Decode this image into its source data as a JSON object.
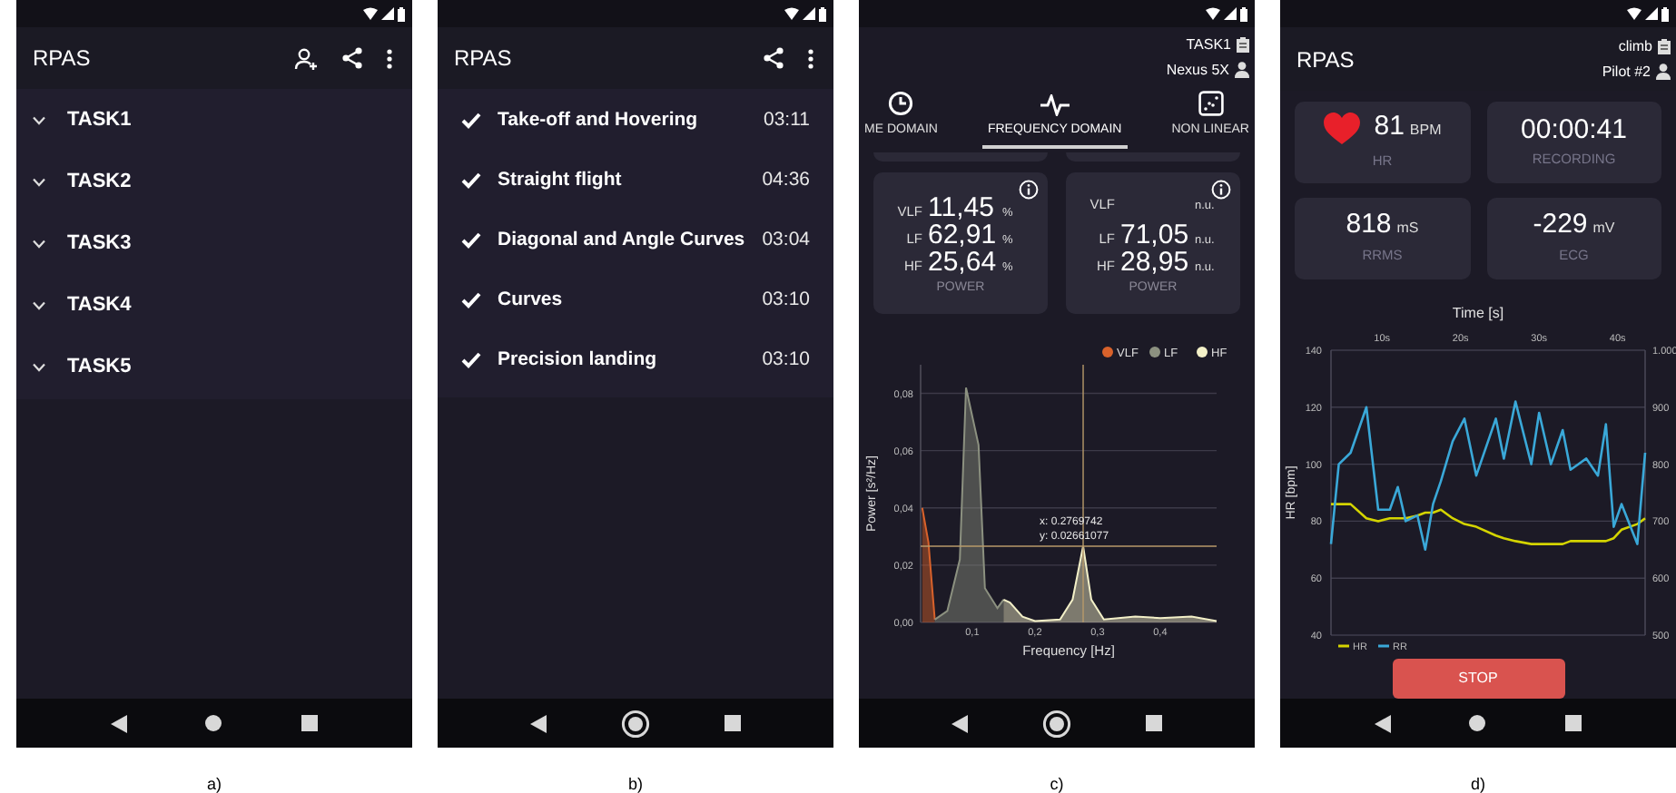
{
  "panels": [
    {
      "kind": "task_list",
      "caption": "a)",
      "app_bar": {
        "title": "RPAS"
      },
      "tasks": [
        {
          "label": "TASK1",
          "expanded": false
        },
        {
          "label": "TASK2",
          "expanded": false
        },
        {
          "label": "TASK3",
          "expanded": false
        },
        {
          "label": "TASK4",
          "expanded": false
        },
        {
          "label": "TASK5",
          "expanded": false
        }
      ]
    },
    {
      "kind": "checklist",
      "caption": "b)",
      "app_bar": {
        "title": "RPAS"
      },
      "items": [
        {
          "label": "Take-off and Hovering",
          "time": "03:11",
          "checked": true
        },
        {
          "label": "Straight flight",
          "time": "04:36",
          "checked": true
        },
        {
          "label": "Diagonal and Angle Curves",
          "time": "03:04",
          "checked": true
        },
        {
          "label": "Curves",
          "time": "03:10",
          "checked": true
        },
        {
          "label": "Precision landing",
          "time": "03:10",
          "checked": true
        }
      ]
    },
    {
      "kind": "frequency",
      "caption": "c)",
      "header": {
        "task": "TASK1",
        "device": "Nexus 5X"
      },
      "tabs": [
        {
          "label": "ME DOMAIN",
          "kind": "clock",
          "selected": false
        },
        {
          "label": "FREQUENCY DOMAIN",
          "kind": "pulse",
          "selected": true
        },
        {
          "label": "NON LINEAR",
          "kind": "scatter",
          "selected": false
        }
      ],
      "cards": [
        {
          "rows": [
            {
              "band": "VLF",
              "value": "11,45",
              "unit": "%"
            },
            {
              "band": "LF",
              "value": "62,91",
              "unit": "%"
            },
            {
              "band": "HF",
              "value": "25,64",
              "unit": "%"
            }
          ],
          "caption": "POWER"
        },
        {
          "rows": [
            {
              "band": "VLF",
              "unit": "n.u."
            },
            {
              "band": "LF",
              "value": "71,05",
              "unit": "n.u."
            },
            {
              "band": "HF",
              "value": "28,95",
              "unit": "n.u."
            }
          ],
          "caption": "POWER"
        }
      ],
      "chart_data": {
        "type": "area",
        "xlabel": "Frequency [Hz]",
        "ylabel": "Power [s²/Hz]",
        "xlim": [
          0.0175,
          0.49
        ],
        "ylim": [
          0,
          0.09
        ],
        "xticks": [
          {
            "value": 0.1,
            "label": "0,1"
          },
          {
            "value": 0.2,
            "label": "0,2"
          },
          {
            "value": 0.3,
            "label": "0,3"
          },
          {
            "value": 0.4,
            "label": "0,4"
          }
        ],
        "yticks": [
          {
            "value": 0,
            "label": "0,00"
          },
          {
            "value": 0.02,
            "label": "0,02"
          },
          {
            "value": 0.04,
            "label": "0,04"
          },
          {
            "value": 0.06,
            "label": "0,06"
          },
          {
            "value": 0.08,
            "label": "0,08"
          }
        ],
        "x": [
          0.02,
          0.03,
          0.04,
          0.06,
          0.08,
          0.09,
          0.11,
          0.12,
          0.14,
          0.15,
          0.16,
          0.18,
          0.2,
          0.24,
          0.26,
          0.277,
          0.29,
          0.31,
          0.36,
          0.4,
          0.45,
          0.49
        ],
        "series": [
          {
            "name": "VLF",
            "color": "#d9622b",
            "values": [
              0.04,
              0.028,
              0.001,
              null,
              null,
              null,
              null,
              null,
              null,
              null,
              null,
              null,
              null,
              null,
              null,
              null,
              null,
              null,
              null,
              null,
              null,
              null
            ]
          },
          {
            "name": "LF",
            "color": "#8c9180",
            "values": [
              null,
              null,
              0.001,
              0.004,
              0.022,
              0.082,
              0.062,
              0.012,
              0.005,
              0.008,
              null,
              null,
              null,
              null,
              null,
              null,
              null,
              null,
              null,
              null,
              null,
              null
            ]
          },
          {
            "name": "HF",
            "color": "#f3f0c8",
            "values": [
              null,
              null,
              null,
              null,
              null,
              null,
              null,
              null,
              null,
              0.008,
              0.007,
              0.002,
              0.0005,
              0.001,
              0.008,
              0.0266,
              0.008,
              0.001,
              0.002,
              0.0015,
              0.002,
              0.0005
            ]
          }
        ],
        "grid": true,
        "legend": "upper right",
        "ref_lines": [
          {
            "axis": "x",
            "value": 0.2769742,
            "color": "#b89a6a"
          },
          {
            "axis": "y",
            "value": 0.02661077,
            "color": "#b89a6a"
          }
        ],
        "annotations": [
          {
            "text": "x: 0.2769742",
            "x": 0.2769742,
            "y": 0.02661077
          },
          {
            "text": "y: 0.02661077",
            "x": 0.2769742,
            "y": 0.02661077
          }
        ]
      }
    },
    {
      "kind": "monitor",
      "caption": "d)",
      "app_bar": {
        "title": "RPAS",
        "task": "climb",
        "pilot": "Pilot #2"
      },
      "cards": [
        {
          "kind": "heart",
          "value": "81",
          "unit": "BPM",
          "label": "HR"
        },
        {
          "kind": "plain",
          "value": "00:00:41",
          "label": "RECORDING"
        },
        {
          "kind": "plain",
          "value": "818",
          "unit": "mS",
          "label": "RRMS"
        },
        {
          "kind": "plain",
          "value": "-229",
          "unit": "mV",
          "label": "ECG"
        }
      ],
      "chart_data": {
        "type": "line",
        "grid": true,
        "legend": "lower left",
        "xlabel": "Time [s]",
        "ylabel": "HR [bpm]",
        "xlim": [
          3.5,
          43.5
        ],
        "ylim": [
          40,
          140
        ],
        "y2lim": [
          500,
          1000
        ],
        "xticks": [
          {
            "value": 10,
            "label": "10s"
          },
          {
            "value": 20,
            "label": "20s"
          },
          {
            "value": 30,
            "label": "30s"
          },
          {
            "value": 40,
            "label": "40s"
          }
        ],
        "yticks": [
          40,
          60,
          80,
          100,
          120,
          140
        ],
        "y2ticks": [
          500,
          600,
          700,
          800,
          900,
          {
            "value": 1000,
            "label": "1.000"
          }
        ],
        "x": [
          3.5,
          4.5,
          6,
          8,
          9.5,
          11,
          12,
          13,
          14.5,
          15.5,
          16.5,
          17.5,
          19,
          20.5,
          22,
          24.5,
          25.5,
          27,
          29,
          30,
          31.5,
          33,
          34,
          36,
          37.5,
          38.5,
          39.5,
          40.5,
          42.5,
          43.5
        ],
        "series": [
          {
            "name": "HR",
            "color": "#d4d400",
            "values": [
              86,
              86,
              86,
              81,
              80,
              81,
              81,
              81,
              82,
              83,
              83,
              84,
              81,
              79,
              78,
              75,
              74,
              73,
              72,
              72,
              72,
              72,
              73,
              73,
              73,
              73,
              74,
              77,
              79,
              81
            ]
          },
          {
            "name": "RR",
            "color": "#3aa8d8",
            "axis": "y2",
            "values": [
              660,
              800,
              820,
              900,
              720,
              720,
              760,
              700,
              710,
              650,
              730,
              770,
              840,
              880,
              780,
              880,
              810,
              910,
              800,
              890,
              800,
              860,
              790,
              810,
              780,
              870,
              690,
              730,
              660,
              820
            ]
          }
        ]
      },
      "stop_button": "STOP"
    }
  ]
}
